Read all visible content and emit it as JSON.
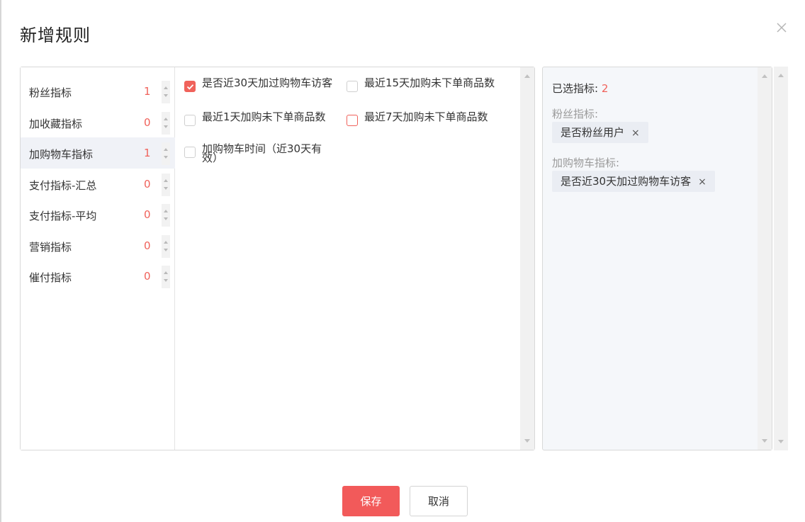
{
  "dialog": {
    "title": "新增规则",
    "close_icon": "close-icon"
  },
  "colors": {
    "accent": "#f0625b",
    "primary_button": "#f25a5a"
  },
  "categories": [
    {
      "label": "粉丝指标",
      "count": "1"
    },
    {
      "label": "加收藏指标",
      "count": "0"
    },
    {
      "label": "加购物车指标",
      "count": "1"
    },
    {
      "label": "支付指标-汇总",
      "count": "0"
    },
    {
      "label": "支付指标-平均",
      "count": "0"
    },
    {
      "label": "营销指标",
      "count": "0"
    },
    {
      "label": "催付指标",
      "count": "0"
    }
  ],
  "active_category": "加购物车指标",
  "options": [
    {
      "label": "是否近30天加过购物车访客",
      "checked": true
    },
    {
      "label": "最近15天加购未下单商品数",
      "checked": false
    },
    {
      "label": "最近1天加购未下单商品数",
      "checked": false
    },
    {
      "label": "最近7天加购未下单商品数",
      "checked": false
    },
    {
      "label": "加购物车时间（近30天有效）",
      "checked": false
    }
  ],
  "selected": {
    "title": "已选指标: ",
    "count": "2",
    "groups": [
      {
        "title": "粉丝指标:",
        "tags": [
          "是否粉丝用户"
        ]
      },
      {
        "title": "加购物车指标:",
        "tags": [
          "是否近30天加过购物车访客"
        ]
      }
    ],
    "remove_glyph": "×"
  },
  "buttons": {
    "save": "保存",
    "cancel": "取消"
  }
}
